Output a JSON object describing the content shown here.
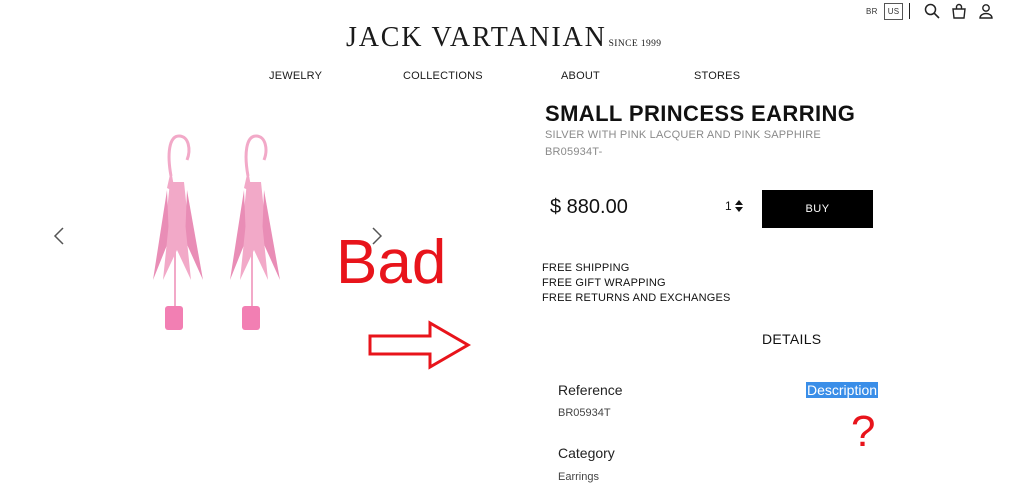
{
  "header": {
    "locale_options": [
      "BR",
      "US"
    ],
    "selected_locale": "US",
    "icons": [
      "search-icon",
      "bag-icon",
      "user-icon"
    ],
    "logo_main": "JACK VARTANIAN",
    "logo_since": "SINCE 1999"
  },
  "nav": {
    "items": [
      {
        "label": "JEWELRY"
      },
      {
        "label": "COLLECTIONS"
      },
      {
        "label": "ABOUT"
      },
      {
        "label": "STORES"
      }
    ]
  },
  "gallery": {
    "icons": [
      "chevron-left-icon",
      "chevron-right-icon"
    ],
    "earring_color": "#f2a9c8",
    "stone_color": "#f27fb3"
  },
  "product": {
    "title": "SMALL PRINCESS EARRING",
    "subtitle": "SILVER WITH PINK LACQUER AND PINK SAPPHIRE",
    "sku": "BR05934T-",
    "price": "$ 880.00",
    "quantity": "1",
    "buy_label": "BUY",
    "perks": [
      "FREE SHIPPING",
      "FREE GIFT WRAPPING",
      "FREE RETURNS AND EXCHANGES"
    ]
  },
  "details": {
    "heading": "DETAILS",
    "reference_label": "Reference",
    "reference_value": "BR05934T",
    "category_label": "Category",
    "category_value": "Earrings",
    "description_label": "Description"
  },
  "annotations": {
    "bad_text": "Bad",
    "question_text": "?",
    "color": "#e8141b"
  }
}
